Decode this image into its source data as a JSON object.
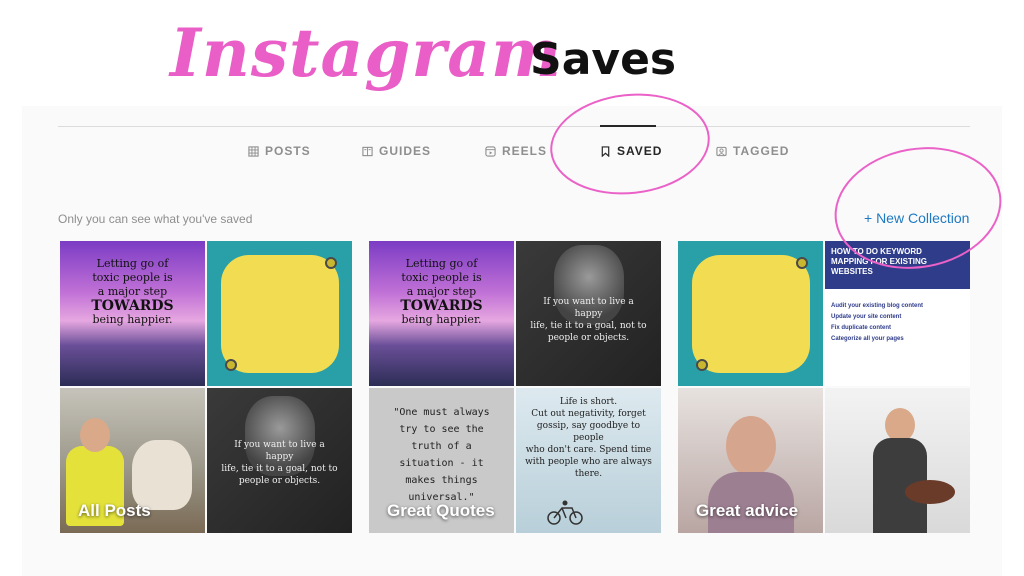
{
  "heading": {
    "script": "Instagram",
    "bold": "Saves"
  },
  "tabs": [
    {
      "label": "POSTS",
      "icon": "grid-icon"
    },
    {
      "label": "GUIDES",
      "icon": "guide-icon"
    },
    {
      "label": "REELS",
      "icon": "reels-icon"
    },
    {
      "label": "SAVED",
      "icon": "bookmark-icon",
      "active": true
    },
    {
      "label": "TAGGED",
      "icon": "tagged-icon"
    }
  ],
  "note": "Only you can see what you've saved",
  "new_collection": "+ New Collection",
  "collections": [
    {
      "name": "All Posts"
    },
    {
      "name": "Great Quotes"
    },
    {
      "name": "Great advice"
    }
  ],
  "tiles": {
    "sunset": {
      "l1": "Letting go of",
      "l2": "toxic people is",
      "l3": "a major step",
      "l4": "TOWARDS",
      "l5": "being happier."
    },
    "einstein": {
      "l1": "If you want to live a happy",
      "l2": "life, tie it to a goal, not to",
      "l3": "people or objects."
    },
    "quote": {
      "l1": "\"One must always",
      "l2": "try to see the",
      "l3": "truth of a",
      "l4": "situation - it",
      "l5": "makes things",
      "l6": "universal.\""
    },
    "life": {
      "l1": "Life is short.",
      "l2": "Cut out negativity, forget",
      "l3": "gossip, say goodbye to people",
      "l4": "who don't care. Spend time",
      "l5": "with people who are always",
      "l6": "there."
    },
    "blog": {
      "title1": "HOW TO DO KEYWORD",
      "title2": "MAPPING FOR EXISTING",
      "title3": "WEBSITES",
      "items": [
        "Audit your existing blog content",
        "Update your site content",
        "Fix duplicate content",
        "Categorize all your pages"
      ]
    }
  },
  "colors": {
    "accent_pink": "#e95fc7",
    "link_blue": "#1d79c2",
    "teal": "#29a0a8",
    "yellow": "#f1dc52"
  }
}
